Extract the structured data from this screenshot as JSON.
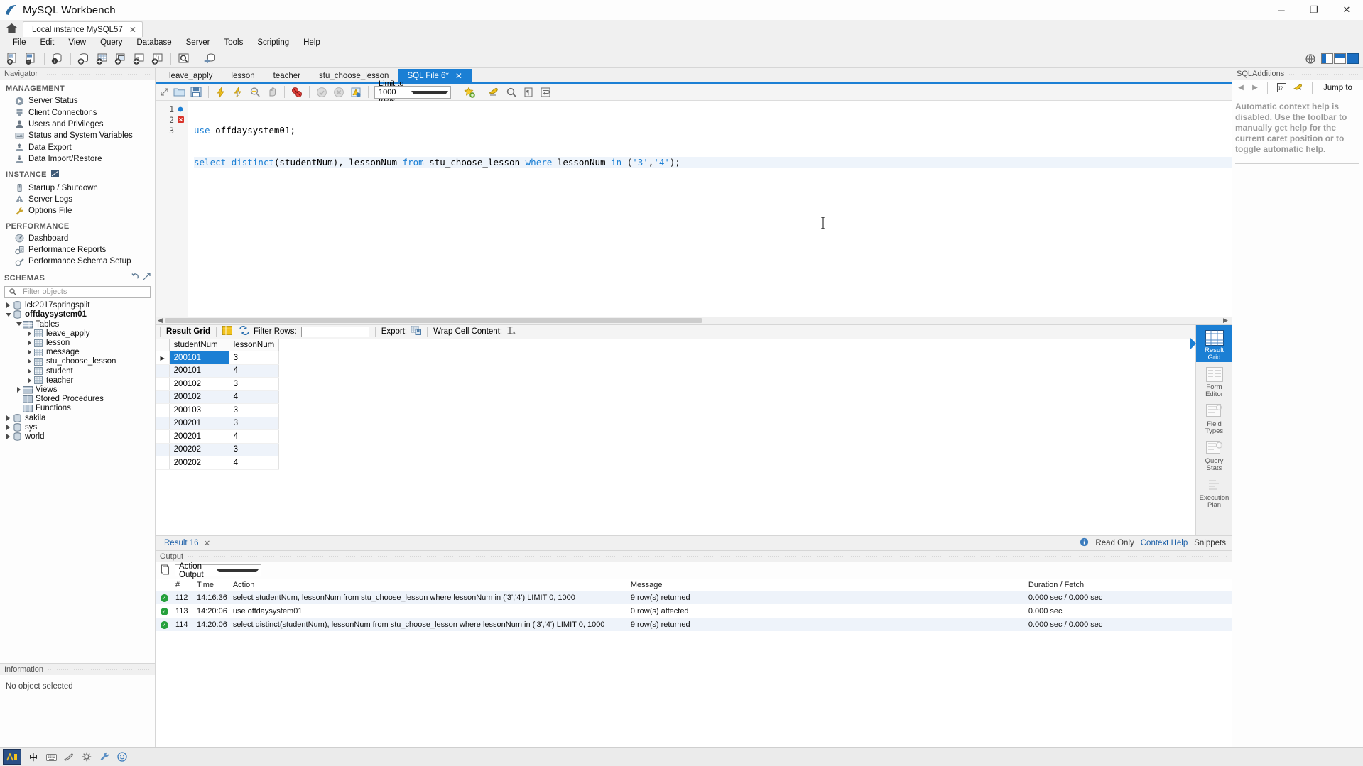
{
  "window": {
    "title": "MySQL Workbench",
    "minimize": "─",
    "maximize": "❐",
    "close": "✕"
  },
  "connection_tab": {
    "label": "Local instance MySQL57",
    "close": "✕"
  },
  "menubar": [
    "File",
    "Edit",
    "View",
    "Query",
    "Database",
    "Server",
    "Tools",
    "Scripting",
    "Help"
  ],
  "navigator": {
    "header": "Navigator",
    "groups": [
      {
        "title": "MANAGEMENT",
        "items": [
          {
            "label": "Server Status",
            "icon": "server-status-icon"
          },
          {
            "label": "Client Connections",
            "icon": "client-connections-icon"
          },
          {
            "label": "Users and Privileges",
            "icon": "users-icon"
          },
          {
            "label": "Status and System Variables",
            "icon": "status-variables-icon"
          },
          {
            "label": "Data Export",
            "icon": "data-export-icon"
          },
          {
            "label": "Data Import/Restore",
            "icon": "data-import-icon"
          }
        ]
      },
      {
        "title": "INSTANCE",
        "items": [
          {
            "label": "Startup / Shutdown",
            "icon": "startup-shutdown-icon"
          },
          {
            "label": "Server Logs",
            "icon": "server-logs-icon"
          },
          {
            "label": "Options File",
            "icon": "options-file-icon"
          }
        ]
      },
      {
        "title": "PERFORMANCE",
        "items": [
          {
            "label": "Dashboard",
            "icon": "dashboard-icon"
          },
          {
            "label": "Performance Reports",
            "icon": "performance-reports-icon"
          },
          {
            "label": "Performance Schema Setup",
            "icon": "performance-schema-icon"
          }
        ]
      }
    ],
    "schemas": {
      "title": "SCHEMAS",
      "filter_placeholder": "Filter objects",
      "filter_value": "",
      "tree": [
        {
          "label": "lck2017springsplit",
          "depth": 0,
          "state": "collapsed",
          "icon": "schema-icon",
          "bold": false
        },
        {
          "label": "offdaysystem01",
          "depth": 0,
          "state": "expanded",
          "icon": "schema-icon",
          "bold": true
        },
        {
          "label": "Tables",
          "depth": 1,
          "state": "expanded",
          "icon": "folder-tables-icon",
          "bold": false
        },
        {
          "label": "leave_apply",
          "depth": 2,
          "state": "collapsed",
          "icon": "table-icon",
          "bold": false
        },
        {
          "label": "lesson",
          "depth": 2,
          "state": "collapsed",
          "icon": "table-icon",
          "bold": false
        },
        {
          "label": "message",
          "depth": 2,
          "state": "collapsed",
          "icon": "table-icon",
          "bold": false
        },
        {
          "label": "stu_choose_lesson",
          "depth": 2,
          "state": "collapsed",
          "icon": "table-icon",
          "bold": false
        },
        {
          "label": "student",
          "depth": 2,
          "state": "collapsed",
          "icon": "table-icon",
          "bold": false
        },
        {
          "label": "teacher",
          "depth": 2,
          "state": "collapsed",
          "icon": "table-icon",
          "bold": false
        },
        {
          "label": "Views",
          "depth": 1,
          "state": "collapsed",
          "icon": "folder-views-icon",
          "bold": false
        },
        {
          "label": "Stored Procedures",
          "depth": 1,
          "state": "none",
          "icon": "folder-procs-icon",
          "bold": false
        },
        {
          "label": "Functions",
          "depth": 1,
          "state": "none",
          "icon": "folder-funcs-icon",
          "bold": false
        },
        {
          "label": "sakila",
          "depth": 0,
          "state": "collapsed",
          "icon": "schema-icon",
          "bold": false
        },
        {
          "label": "sys",
          "depth": 0,
          "state": "collapsed",
          "icon": "schema-icon",
          "bold": false
        },
        {
          "label": "world",
          "depth": 0,
          "state": "collapsed",
          "icon": "schema-icon",
          "bold": false
        }
      ]
    },
    "information": {
      "header": "Information",
      "empty_text": "No object selected"
    }
  },
  "editor": {
    "tabs": [
      {
        "label": "leave_apply",
        "active": false
      },
      {
        "label": "lesson",
        "active": false
      },
      {
        "label": "teacher",
        "active": false
      },
      {
        "label": "stu_choose_lesson",
        "active": false
      },
      {
        "label": "SQL File 6*",
        "active": true
      }
    ],
    "toolbar": {
      "limit_label": "Limit to 1000 rows"
    },
    "lines": [
      {
        "num": "1",
        "marker": "bookmark",
        "text": "use offdaysystem01;"
      },
      {
        "num": "2",
        "marker": "error",
        "text": "select distinct(studentNum), lessonNum from stu_choose_lesson where lessonNum in ('3','4');"
      },
      {
        "num": "3",
        "marker": "",
        "text": ""
      }
    ]
  },
  "result": {
    "toolbar": {
      "result_grid_label": "Result Grid",
      "filter_rows_label": "Filter Rows:",
      "filter_value": "",
      "export_label": "Export:",
      "wrap_cell_label": "Wrap Cell Content:"
    },
    "columns": [
      "studentNum",
      "lessonNum"
    ],
    "rows": [
      {
        "studentNum": "200101",
        "lessonNum": "3"
      },
      {
        "studentNum": "200101",
        "lessonNum": "4"
      },
      {
        "studentNum": "200102",
        "lessonNum": "3"
      },
      {
        "studentNum": "200102",
        "lessonNum": "4"
      },
      {
        "studentNum": "200103",
        "lessonNum": "3"
      },
      {
        "studentNum": "200201",
        "lessonNum": "3"
      },
      {
        "studentNum": "200201",
        "lessonNum": "4"
      },
      {
        "studentNum": "200202",
        "lessonNum": "3"
      },
      {
        "studentNum": "200202",
        "lessonNum": "4"
      }
    ],
    "selected_cell": {
      "row": 0,
      "column": "studentNum"
    },
    "side_panel": [
      {
        "label": "Result\nGrid",
        "active": true,
        "icon": "result-grid-icon"
      },
      {
        "label": "Form\nEditor",
        "active": false,
        "icon": "form-editor-icon"
      },
      {
        "label": "Field\nTypes",
        "active": false,
        "icon": "field-types-icon"
      },
      {
        "label": "Query\nStats",
        "active": false,
        "icon": "query-stats-icon"
      },
      {
        "label": "Execution\nPlan",
        "active": false,
        "icon": "execution-plan-icon"
      }
    ],
    "footer": {
      "tab_label": "Result 16",
      "tab_close": "✕",
      "read_only": "Read Only",
      "context_help": "Context Help",
      "snippets": "Snippets"
    }
  },
  "output": {
    "header": "Output",
    "selector": "Action Output",
    "columns": [
      "#",
      "Time",
      "Action",
      "Message",
      "Duration / Fetch"
    ],
    "rows": [
      {
        "num": "112",
        "time": "14:16:36",
        "action": "select studentNum, lessonNum from stu_choose_lesson where lessonNum in ('3','4') LIMIT 0, 1000",
        "message": "9 row(s) returned",
        "duration": "0.000 sec / 0.000 sec",
        "status": "ok"
      },
      {
        "num": "113",
        "time": "14:20:06",
        "action": "use offdaysystem01",
        "message": "0 row(s) affected",
        "duration": "0.000 sec",
        "status": "ok"
      },
      {
        "num": "114",
        "time": "14:20:06",
        "action": "select distinct(studentNum), lessonNum from stu_choose_lesson where lessonNum in ('3','4') LIMIT 0, 1000",
        "message": "9 row(s) returned",
        "duration": "0.000 sec / 0.000 sec",
        "status": "ok"
      }
    ]
  },
  "sql_additions": {
    "header": "SQLAdditions",
    "jump_to": "Jump to",
    "body_text": "Automatic context help is disabled. Use the toolbar to manually get help for the current caret position or to toggle automatic help."
  },
  "statusbar": {
    "ime_label": "中",
    "box_label": "S"
  },
  "colors": {
    "accent": "#1b7fd4",
    "keyword": "#1b7fd4",
    "selection": "#1b7fd4",
    "ok_green": "#25a03c",
    "error_red": "#d9342b"
  }
}
